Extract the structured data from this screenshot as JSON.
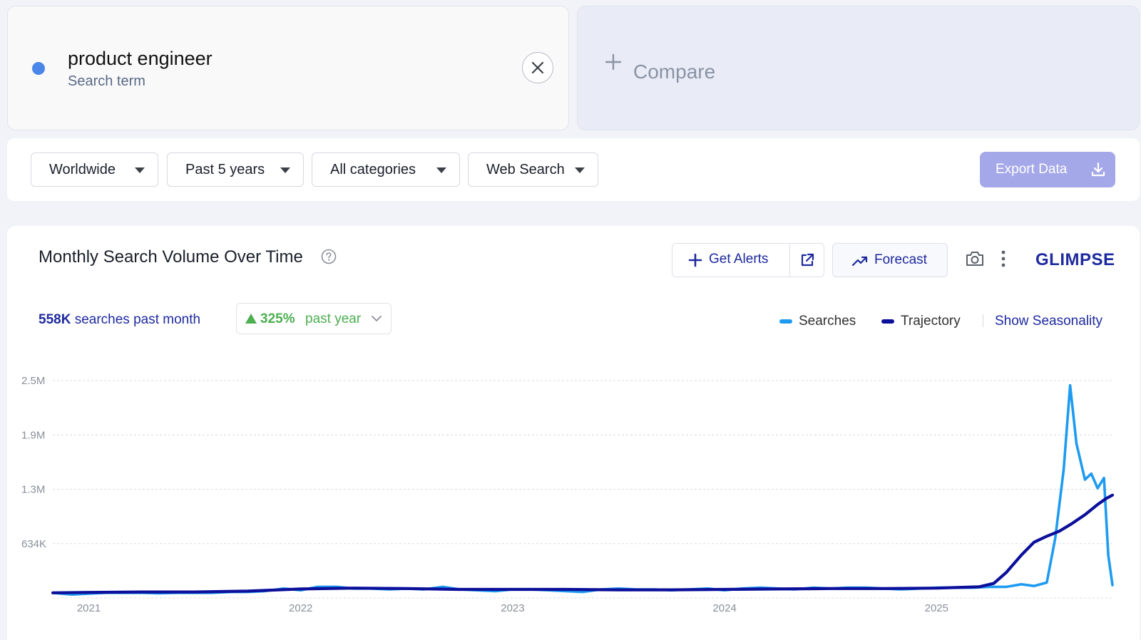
{
  "term": {
    "name": "product engineer",
    "type": "Search term",
    "dot_color": "#4a86e8",
    "close_icon": "close-icon"
  },
  "compare": {
    "label": "Compare",
    "icon": "plus-icon"
  },
  "filters": {
    "location": "Worldwide",
    "period": "Past 5 years",
    "category": "All categories",
    "source": "Web Search",
    "export_label": "Export Data"
  },
  "panel": {
    "title": "Monthly Search Volume Over Time",
    "alerts_label": "Get Alerts",
    "forecast_label": "Forecast",
    "brand": "GLIMPSE",
    "stat_value": "558K",
    "stat_label": "searches past month",
    "growth_value": "325%",
    "growth_label": "past year",
    "legend_searches": "Searches",
    "legend_trajectory": "Trajectory",
    "show_seasonality": "Show Seasonality",
    "accent": "#1e2a9e",
    "growth_color": "#4caf50"
  },
  "chart_data": {
    "type": "line",
    "title": "Monthly Search Volume Over Time",
    "xlabel": "",
    "ylabel": "",
    "y_ticks": [
      {
        "value": 0,
        "label": ""
      },
      {
        "value": 634000,
        "label": "634K"
      },
      {
        "value": 1268000,
        "label": "1.3M"
      },
      {
        "value": 1902000,
        "label": "1.9M"
      },
      {
        "value": 2536000,
        "label": "2.5M"
      }
    ],
    "ylim": [
      0,
      2536000
    ],
    "x_ticks": [
      {
        "value": 2021.0,
        "label": "2021"
      },
      {
        "value": 2022.0,
        "label": "2022"
      },
      {
        "value": 2023.0,
        "label": "2023"
      },
      {
        "value": 2024.0,
        "label": "2024"
      },
      {
        "value": 2025.0,
        "label": "2025"
      }
    ],
    "xlim": [
      2020.83,
      2025.83
    ],
    "grid": true,
    "legend": "top-right",
    "series": [
      {
        "name": "Searches",
        "color": "#1e9bf0",
        "x": [
          2020.83,
          2020.92,
          2021.0,
          2021.08,
          2021.17,
          2021.25,
          2021.33,
          2021.42,
          2021.5,
          2021.58,
          2021.67,
          2021.75,
          2021.83,
          2021.92,
          2022.0,
          2022.08,
          2022.17,
          2022.25,
          2022.33,
          2022.42,
          2022.5,
          2022.58,
          2022.67,
          2022.75,
          2022.83,
          2022.92,
          2023.0,
          2023.08,
          2023.17,
          2023.25,
          2023.33,
          2023.42,
          2023.5,
          2023.58,
          2023.67,
          2023.75,
          2023.83,
          2023.92,
          2024.0,
          2024.08,
          2024.17,
          2024.25,
          2024.33,
          2024.42,
          2024.5,
          2024.58,
          2024.67,
          2024.75,
          2024.83,
          2024.92,
          2025.0,
          2025.08,
          2025.17,
          2025.25,
          2025.33,
          2025.4,
          2025.46,
          2025.52,
          2025.56,
          2025.6,
          2025.63,
          2025.66,
          2025.7,
          2025.73,
          2025.76,
          2025.79,
          2025.81,
          2025.83
        ],
        "values": [
          60000,
          40000,
          50000,
          60000,
          60000,
          60000,
          55000,
          60000,
          60000,
          60000,
          70000,
          70000,
          80000,
          110000,
          90000,
          130000,
          130000,
          110000,
          110000,
          100000,
          110000,
          100000,
          130000,
          100000,
          90000,
          80000,
          100000,
          100000,
          90000,
          80000,
          70000,
          100000,
          110000,
          100000,
          100000,
          90000,
          100000,
          110000,
          90000,
          110000,
          120000,
          110000,
          100000,
          120000,
          110000,
          120000,
          120000,
          110000,
          100000,
          110000,
          120000,
          120000,
          120000,
          130000,
          130000,
          160000,
          140000,
          180000,
          700000,
          1500000,
          2480000,
          1800000,
          1380000,
          1450000,
          1280000,
          1400000,
          500000,
          150000
        ]
      },
      {
        "name": "Trajectory",
        "color": "#0b0f9a",
        "x": [
          2020.83,
          2021.0,
          2021.25,
          2021.5,
          2021.75,
          2022.0,
          2022.25,
          2022.5,
          2022.75,
          2023.0,
          2023.25,
          2023.5,
          2023.75,
          2024.0,
          2024.25,
          2024.5,
          2024.75,
          2025.0,
          2025.2,
          2025.27,
          2025.33,
          2025.4,
          2025.46,
          2025.52,
          2025.58,
          2025.64,
          2025.7,
          2025.76,
          2025.8,
          2025.83
        ],
        "values": [
          60000,
          65000,
          70000,
          70000,
          80000,
          105000,
          115000,
          110000,
          100000,
          100000,
          100000,
          95000,
          95000,
          100000,
          105000,
          110000,
          110000,
          115000,
          130000,
          170000,
          300000,
          500000,
          650000,
          720000,
          780000,
          870000,
          970000,
          1090000,
          1160000,
          1200000
        ]
      }
    ]
  }
}
